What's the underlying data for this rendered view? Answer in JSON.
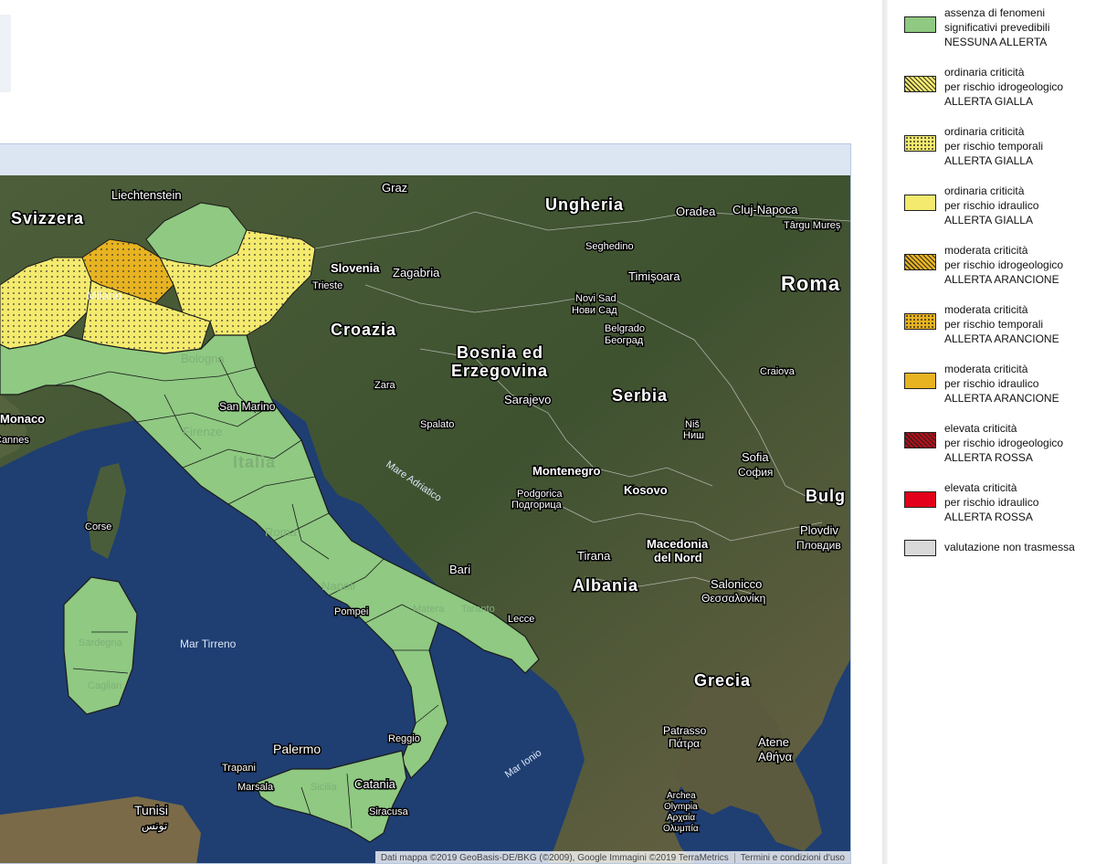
{
  "colors": {
    "green": "#8fc982",
    "yellow": "#f4ea6e",
    "orange": "#e8b321",
    "red_dark": "#b0101a",
    "red": "#e2001a",
    "gray": "#d9d9d9",
    "sea": "#1d3b6e"
  },
  "map": {
    "labels": {
      "svizzera": "Svizzera",
      "liechtenstein": "Liechtenstein",
      "graz": "Graz",
      "ungheria": "Ungheria",
      "oradea": "Oradea",
      "cluj": "Cluj-Napoca",
      "targu": "Târgu Mureș",
      "seghedino": "Seghedino",
      "slovenia": "Slovenia",
      "zagabria": "Zagabria",
      "timisoara": "Timișoara",
      "roma_ro": "Roma",
      "novisad1": "Novi Sad",
      "novisad2": "Нови Сад",
      "croazia": "Croazia",
      "belgrado1": "Belgrado",
      "belgrado2": "Београд",
      "milano": "Milano",
      "trieste": "Trieste",
      "bologna": "Bologna",
      "sanmarino": "San Marino",
      "bosnia1": "Bosnia ed",
      "bosnia2": "Erzegovina",
      "zara": "Zara",
      "sarajevo": "Sarajevo",
      "serbia": "Serbia",
      "craiova": "Craiova",
      "monaco": "Monaco",
      "cannes": "Cannes",
      "spalato": "Spalato",
      "nis1": "Niš",
      "nis2": "Ниш",
      "sofia1": "Sofia",
      "sofia2": "София",
      "firenze": "Firenze",
      "italia": "Italia",
      "mareadriatico": "Mare Adriatico",
      "montenegro": "Montenegro",
      "podgorica1": "Podgorica",
      "podgorica2": "Подгорица",
      "kosovo": "Kosovo",
      "bulg": "Bulg",
      "corse": "Corse",
      "roma_it": "Roma",
      "plovdiv1": "Plovdiv",
      "plovdiv2": "Пловдив",
      "tirana": "Tirana",
      "macedonia1": "Macedonia",
      "macedonia2": "del Nord",
      "bari": "Bari",
      "albania": "Albania",
      "napoli": "Napoli",
      "salonicco1": "Salonicco",
      "salonicco2": "Θεσσαλονίκη",
      "pompei": "Pompei",
      "matera": "Matera",
      "taranto": "Taranto",
      "lecce": "Lecce",
      "sardegna": "Sardegna",
      "martirreno": "Mar Tirreno",
      "cagliari": "Cagliari",
      "grecia": "Grecia",
      "patrasso1": "Patrasso",
      "patrasso2": "Πάτρα",
      "reggio": "Reggio",
      "palermo": "Palermo",
      "marionio": "Mar Ionio",
      "atene1": "Atene",
      "atene2": "Αθήνα",
      "trapani": "Trapani",
      "marsala": "Marsala",
      "sicilia": "Sicilia",
      "catania": "Catania",
      "siracusa": "Siracusa",
      "tunisi1": "Tunisi",
      "tunisi2": "تونس",
      "archea1": "Archea",
      "archea2": "Olympia",
      "archea3": "Αρχαία",
      "archea4": "Ολυμπία"
    },
    "attribution": "Dati mappa ©2019 GeoBasis-DE/BKG (©2009), Google Immagini ©2019 TerraMetrics",
    "terms": "Termini e condizioni d'uso"
  },
  "legend": [
    {
      "lines": [
        "assenza di fenomeni",
        "significativi prevedibili",
        "NESSUNA ALLERTA"
      ],
      "color": "#8fc982",
      "pattern": "none"
    },
    {
      "lines": [
        "ordinaria criticità",
        "per rischio idrogeologico",
        "ALLERTA GIALLA"
      ],
      "color": "#f4ea6e",
      "pattern": "hatch"
    },
    {
      "lines": [
        "ordinaria criticità",
        "per rischio temporali",
        "ALLERTA GIALLA"
      ],
      "color": "#f4ea6e",
      "pattern": "dots"
    },
    {
      "lines": [
        "ordinaria criticità",
        "per rischio idraulico",
        "ALLERTA GIALLA"
      ],
      "color": "#f4ea6e",
      "pattern": "none"
    },
    {
      "lines": [
        "moderata criticità",
        "per rischio idrogeologico",
        "ALLERTA ARANCIONE"
      ],
      "color": "#e8b321",
      "pattern": "hatch"
    },
    {
      "lines": [
        "moderata criticità",
        "per rischio temporali",
        "ALLERTA ARANCIONE"
      ],
      "color": "#e8b321",
      "pattern": "dots"
    },
    {
      "lines": [
        "moderata criticità",
        "per rischio idraulico",
        "ALLERTA ARANCIONE"
      ],
      "color": "#e8b321",
      "pattern": "none"
    },
    {
      "lines": [
        "elevata criticità",
        "per rischio idrogeologico",
        "ALLERTA ROSSA"
      ],
      "color": "#b0101a",
      "pattern": "hatch"
    },
    {
      "lines": [
        "elevata criticità",
        "per rischio idraulico",
        "ALLERTA ROSSA"
      ],
      "color": "#e2001a",
      "pattern": "none"
    },
    {
      "lines": [
        "valutazione non trasmessa"
      ],
      "color": "#d9d9d9",
      "pattern": "none"
    }
  ]
}
